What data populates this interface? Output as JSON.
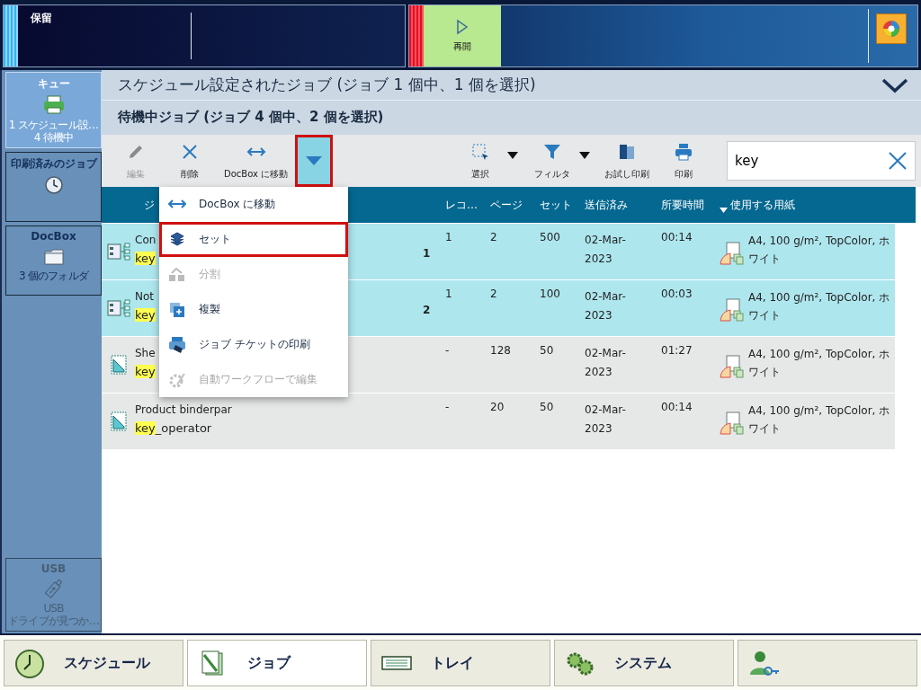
{
  "top_bar": {
    "status_label": "保留",
    "resume_button": "再開"
  },
  "sidebar": {
    "items": [
      {
        "kind": "queue",
        "title": "キュー",
        "lines": [
          "1 スケジュール設…",
          "4 待機中"
        ],
        "selected": true,
        "disabled": false
      },
      {
        "kind": "history",
        "title": "印刷済みのジョブ",
        "selected": false,
        "disabled": false
      },
      {
        "kind": "docbox",
        "title": "DocBox",
        "lines": [
          "3 個のフォルダ"
        ],
        "selected": false,
        "disabled": false
      }
    ],
    "usb": {
      "kind": "usb",
      "title": "USB",
      "lines": [
        "USB",
        "ドライブが見つか…"
      ],
      "selected": false,
      "disabled": true
    }
  },
  "scheduled_header": {
    "title": "スケジュール設定されたジョブ (ジョブ 1 個中、1 個を選択)"
  },
  "waiting_header": {
    "title": "待機中ジョブ (ジョブ 4 個中、2 個を選択)"
  },
  "toolbar": {
    "buttons": [
      {
        "kind": "edit",
        "label": "編集",
        "disabled": true
      },
      {
        "kind": "delete",
        "label": "削除",
        "disabled": false
      },
      {
        "kind": "move",
        "label": "DocBox に移動",
        "disabled": false
      },
      {
        "kind": "more",
        "open": true
      },
      {
        "kind": "select",
        "label": "選択",
        "disabled": false,
        "caret": true
      },
      {
        "kind": "filter",
        "label": "フィルタ",
        "disabled": false,
        "caret": true
      },
      {
        "kind": "proof",
        "label": "お試し印刷",
        "disabled": false
      },
      {
        "kind": "print",
        "label": "印刷",
        "disabled": false
      }
    ],
    "search": {
      "value": "key"
    }
  },
  "table": {
    "columns": [
      {
        "label": "ジ",
        "sorted": false
      },
      {
        "label": "レコ…",
        "sorted": false
      },
      {
        "label": "ページ",
        "sorted": false
      },
      {
        "label": "セット",
        "sorted": false
      },
      {
        "label": "送信済み",
        "sorted": false
      },
      {
        "label": "所要時間",
        "sorted": false
      },
      {
        "label": "使用する用紙",
        "sorted": true
      }
    ],
    "rows": [
      {
        "kind": "multi",
        "name": "Con",
        "match": "key",
        "number": "1",
        "records": "1",
        "pages": "2",
        "sets": "500",
        "sent": [
          "02-Mar-",
          "2023"
        ],
        "duration": "00:14",
        "paper": "A4, 100 g/m², TopColor, ホワイト",
        "selected": true
      },
      {
        "kind": "multi",
        "name": "Not",
        "match": "key",
        "number": "2",
        "records": "1",
        "pages": "2",
        "sets": "100",
        "sent": [
          "02-Mar-",
          "2023"
        ],
        "duration": "00:03",
        "paper": "A4, 100 g/m², TopColor, ホワイト",
        "selected": true
      },
      {
        "kind": "single",
        "name": "She",
        "match": "key",
        "records": "-",
        "pages": "128",
        "sets": "50",
        "sent": [
          "02-Mar-",
          "2023"
        ],
        "duration": "01:27",
        "paper": "A4, 100 g/m², TopColor, ホワイト",
        "selected": false
      },
      {
        "kind": "single",
        "name": "Product binderpar",
        "match": "key",
        "rest": "_operator",
        "records": "-",
        "pages": "20",
        "sets": "50",
        "sent": [
          "02-Mar-",
          "2023"
        ],
        "duration": "00:14",
        "paper": "A4, 100 g/m², TopColor, ホワイト",
        "selected": false
      }
    ]
  },
  "menu": {
    "items": [
      {
        "kind": "move",
        "label": "DocBox に移動",
        "disabled": false,
        "selected": false
      },
      {
        "kind": "set",
        "label": "セット",
        "disabled": false,
        "selected": true
      },
      {
        "kind": "split",
        "label": "分割",
        "disabled": true,
        "selected": false
      },
      {
        "kind": "copy",
        "label": "複製",
        "disabled": false,
        "selected": false
      },
      {
        "kind": "ticket",
        "label": "ジョブ チケットの印刷",
        "disabled": false,
        "selected": false
      },
      {
        "kind": "workflow",
        "label": "自動ワークフローで編集",
        "disabled": true,
        "selected": false
      }
    ]
  },
  "bottom_nav": [
    {
      "kind": "schedule",
      "label": "スケジュール",
      "selected": false
    },
    {
      "kind": "jobs",
      "label": "ジョブ",
      "selected": true
    },
    {
      "kind": "tray",
      "label": "トレイ",
      "selected": false
    },
    {
      "kind": "system",
      "label": "システム",
      "selected": false
    },
    {
      "kind": "user",
      "selected": false
    }
  ]
}
